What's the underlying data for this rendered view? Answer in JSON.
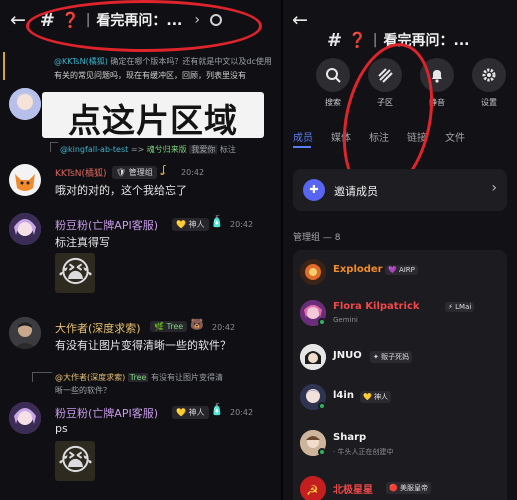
{
  "header": {
    "hash": "#",
    "question": "❓",
    "separator": "|",
    "title": "看完再问：...",
    "chevron": "›"
  },
  "chat": {
    "quote_reply": {
      "user": "@KKTsN(橘狐)",
      "text": "确定在哪个版本吗？还有就是中文以及dc使用",
      "line2": "有关的常见问题吗，现在有缓冲区，回顾，列表里没有"
    },
    "overlay_text": "点这片区域",
    "reply2": {
      "user": "@kingfall-ab-test",
      "arrow": "=>",
      "tag": "魂兮归来版",
      "badge": "我爱你",
      "tail": "标注"
    },
    "messages": [
      {
        "author": "KKTsN(橘狐)",
        "badges": [
          "管理组"
        ],
        "time": "20:42",
        "text": "哦对的对的，这个我给忘了"
      },
      {
        "author": "粉豆粉(亡牌API客服)",
        "badges": [
          "神人"
        ],
        "time": "20:42",
        "text": "标注真得写",
        "emoji": "😭"
      },
      {
        "author": "大作者(深度求索)",
        "badges": [
          "Tree"
        ],
        "time": "20:42",
        "text": "有没有让图片变得清晰一些的软件？"
      },
      {
        "reply": {
          "user": "@大作者(深度求索)",
          "tag": "Tree",
          "text": "有没有让图片变得清",
          "line2": "晰一些的软件？"
        },
        "author": "粉豆粉(亡牌API客服)",
        "badges": [
          "神人"
        ],
        "time": "20:42",
        "text": "ps",
        "emoji": "😭"
      }
    ]
  },
  "panel": {
    "icons": [
      {
        "label": "搜索",
        "icon": "search-icon"
      },
      {
        "label": "子区",
        "icon": "threads-icon"
      },
      {
        "label": "静音",
        "icon": "bell-icon"
      },
      {
        "label": "设置",
        "icon": "gear-icon"
      }
    ],
    "tabs": [
      "成员",
      "媒体",
      "标注",
      "链接",
      "文件"
    ],
    "active_tab": "成员",
    "invite_label": "邀请成员",
    "group_title": "管理组 — 8",
    "members": [
      {
        "name": "Exploder",
        "badge": "AIRP",
        "sub": "",
        "color": "#f28b2a"
      },
      {
        "name": "Flora Kilpatrick",
        "badge": "LMai",
        "sub": "Gemini",
        "color": "#f04848"
      },
      {
        "name": "JNUO",
        "badge": "贩子死妈",
        "sub": "",
        "color": "#f2f2f2"
      },
      {
        "name": "l4in",
        "badge": "神人",
        "sub": "",
        "color": "#f2f2f2"
      },
      {
        "name": "Sharp",
        "badge": "",
        "sub": "· 牛头人正在创建中",
        "color": "#f2f2f2"
      },
      {
        "name": "北极星星",
        "badge": "美服皇帝",
        "sub": "",
        "color": "#f04848"
      }
    ]
  }
}
